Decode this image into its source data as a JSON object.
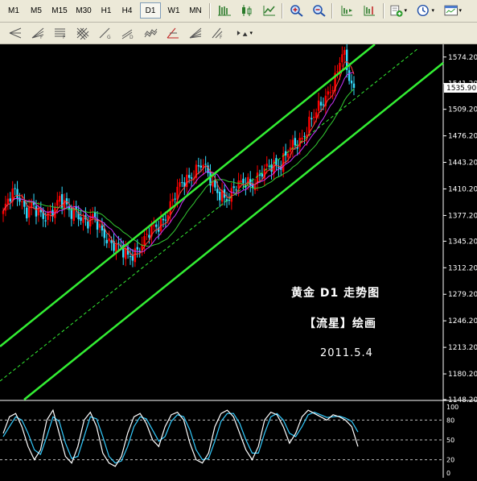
{
  "timeframes": [
    "M1",
    "M5",
    "M15",
    "M30",
    "H1",
    "H4",
    "D1",
    "W1",
    "MN"
  ],
  "active_timeframe": "D1",
  "toolbar_icons": {
    "row1": [
      "bar-chart-icon",
      "candlestick-icon",
      "line-chart-icon",
      "zoom-in-icon",
      "zoom-out-icon",
      "chart-shift-icon",
      "auto-scroll-icon",
      "indicators-icon",
      "periods-icon",
      "templates-icon"
    ],
    "row2": [
      "andrews-pitchfork-icon",
      "fibonacci-fan-icon",
      "fibonacci-retracement-icon",
      "gann-grid-icon",
      "gann-line-icon",
      "equidistant-channel-icon",
      "regression-channel-icon",
      "fibonacci-expansion-icon",
      "gann-fan-icon",
      "fibonacci-time-zones-icon",
      "arrows-icon"
    ]
  },
  "colors": {
    "bullish": "#ff0000",
    "bearish": "#33ddff",
    "channel": "#33ee33",
    "ma_fast": "#ff4040",
    "ma_mid": "#cc33ff",
    "ma_slow": "#33cc33",
    "stoch_main": "#ffffff",
    "stoch_signal": "#33ccff",
    "price_label_bg": "#ffffff"
  },
  "annotation": {
    "line1": "黄金 D1 走势图",
    "line2": "【流星】绘画",
    "date": "2011.5.4"
  },
  "current_price": "1535.90",
  "chart_data": {
    "type": "candlestick",
    "symbol": "黄金",
    "timeframe": "D1",
    "y_ticks": [
      "1574.20",
      "1541.20",
      "1509.20",
      "1476.20",
      "1443.20",
      "1410.20",
      "1377.20",
      "1345.20",
      "1312.20",
      "1279.20",
      "1246.20",
      "1213.20",
      "1180.20",
      "1148.20"
    ],
    "ylim": [
      1148.2,
      1590
    ],
    "price_path": [
      1380,
      1395,
      1405,
      1400,
      1385,
      1390,
      1378,
      1372,
      1380,
      1390,
      1398,
      1385,
      1378,
      1385,
      1375,
      1368,
      1372,
      1360,
      1355,
      1345,
      1338,
      1330,
      1325,
      1332,
      1340,
      1345,
      1355,
      1362,
      1372,
      1382,
      1395,
      1408,
      1420,
      1428,
      1435,
      1440,
      1428,
      1415,
      1410,
      1402,
      1395,
      1410,
      1418,
      1425,
      1415,
      1420,
      1428,
      1440,
      1445,
      1440,
      1450,
      1460,
      1468,
      1478,
      1492,
      1500,
      1510,
      1525,
      1540,
      1555,
      1580,
      1548,
      1535
    ],
    "indicator": {
      "name": "Stochastic",
      "levels": [
        "80",
        "50",
        "20"
      ],
      "scale_labels": [
        "100",
        "80",
        "50",
        "20",
        "0"
      ],
      "ylim": [
        0,
        100
      ],
      "main": [
        60,
        85,
        90,
        70,
        40,
        20,
        35,
        80,
        95,
        60,
        25,
        15,
        40,
        80,
        92,
        70,
        30,
        15,
        10,
        25,
        60,
        85,
        90,
        75,
        50,
        40,
        70,
        88,
        92,
        80,
        45,
        20,
        15,
        30,
        70,
        90,
        95,
        85,
        60,
        35,
        20,
        40,
        80,
        92,
        88,
        70,
        45,
        60,
        85,
        95,
        90,
        85,
        80,
        88,
        85,
        80,
        70,
        40
      ],
      "signal": [
        55,
        70,
        85,
        80,
        60,
        35,
        28,
        55,
        85,
        78,
        45,
        22,
        25,
        55,
        85,
        82,
        55,
        25,
        15,
        18,
        40,
        70,
        85,
        82,
        65,
        48,
        55,
        78,
        88,
        85,
        65,
        35,
        20,
        22,
        48,
        78,
        90,
        90,
        75,
        50,
        30,
        30,
        60,
        85,
        90,
        80,
        60,
        55,
        70,
        88,
        92,
        88,
        84,
        85,
        86,
        83,
        78,
        62
      ]
    }
  }
}
